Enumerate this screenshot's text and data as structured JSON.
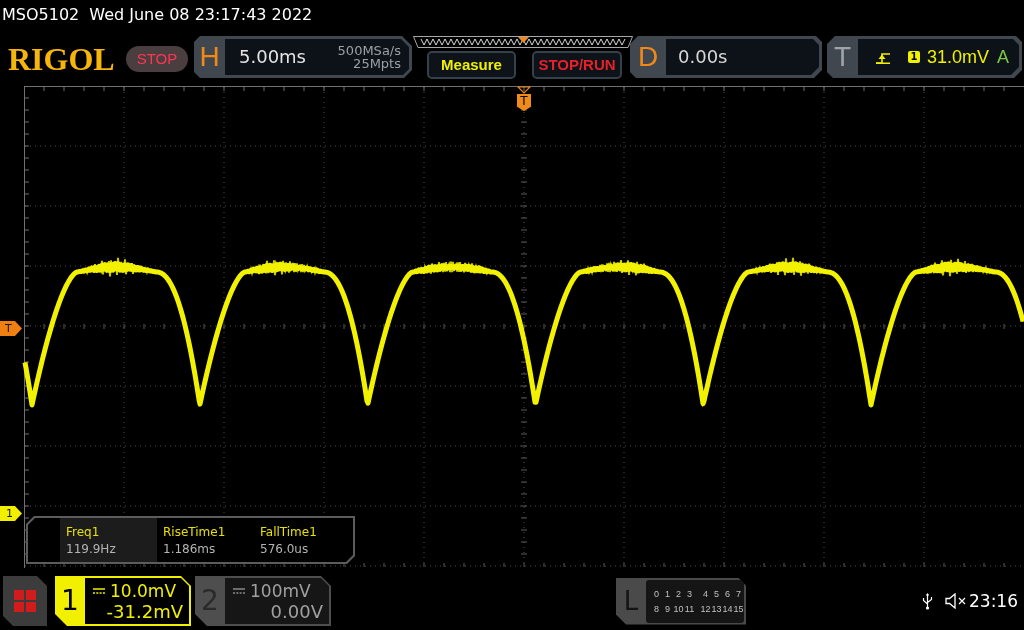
{
  "status_line": {
    "model": "MSO5102",
    "datetime": "Wed June 08 23:17:43 2022"
  },
  "toolbar": {
    "logo": "RIGOL",
    "run_state": {
      "label": "STOP",
      "kind": "stop"
    },
    "horizontal": {
      "label": "H",
      "timebase": "5.00ms",
      "sample_rate": "500MSa/s",
      "memory_depth": "25Mpts"
    },
    "buttons": [
      {
        "label": "Measure",
        "color": "#f0f000"
      },
      {
        "label": "STOP/RUN",
        "color": "#e8202a"
      }
    ],
    "delay": {
      "label": "D",
      "value": "0.00s"
    },
    "trigger": {
      "label": "T",
      "source": "1",
      "level": "31.0mV",
      "mode": "A"
    }
  },
  "screen": {
    "trigger_position_marker": "T",
    "level_markers": [
      {
        "kind": "trigger",
        "label": "T"
      },
      {
        "kind": "channel",
        "label": "1"
      }
    ]
  },
  "measurements": [
    {
      "name": "Freq1",
      "value": "119.9Hz",
      "selected": true
    },
    {
      "name": "RiseTime1",
      "value": "1.186ms",
      "selected": false
    },
    {
      "name": "FallTime1",
      "value": "576.0us",
      "selected": false
    }
  ],
  "channels": [
    {
      "number": "1",
      "scale": "10.0mV",
      "offset": "-31.2mV",
      "on": true
    },
    {
      "number": "2",
      "scale": "100mV",
      "offset": "0.00V",
      "on": false
    }
  ],
  "logic": {
    "label": "L",
    "rows": [
      [
        "0",
        "1",
        "2",
        "3",
        "4",
        "5",
        "6",
        "7"
      ],
      [
        "8",
        "9",
        "10",
        "11",
        "12",
        "13",
        "14",
        "15"
      ]
    ]
  },
  "status_bar": {
    "clock": "23:16"
  }
}
